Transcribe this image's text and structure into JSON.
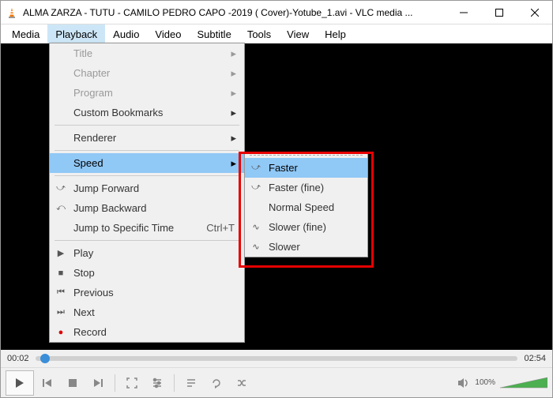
{
  "title": "ALMA ZARZA - TUTU - CAMILO PEDRO CAPO -2019 ( Cover)-Yotube_1.avi - VLC media ...",
  "menubar": [
    "Media",
    "Playback",
    "Audio",
    "Video",
    "Subtitle",
    "Tools",
    "View",
    "Help"
  ],
  "active_menu_index": 1,
  "dropdown": {
    "title": "Title",
    "chapter": "Chapter",
    "program": "Program",
    "bookmarks": "Custom Bookmarks",
    "renderer": "Renderer",
    "speed": "Speed",
    "jump_forward": "Jump Forward",
    "jump_backward": "Jump Backward",
    "jump_specific": "Jump to Specific Time",
    "jump_specific_shortcut": "Ctrl+T",
    "play": "Play",
    "stop": "Stop",
    "previous": "Previous",
    "next": "Next",
    "record": "Record"
  },
  "submenu": {
    "faster": "Faster",
    "faster_fine": "Faster (fine)",
    "normal": "Normal Speed",
    "slower_fine": "Slower (fine)",
    "slower": "Slower"
  },
  "time": {
    "current": "00:02",
    "duration": "02:54"
  },
  "volume": {
    "percent": "100%"
  }
}
